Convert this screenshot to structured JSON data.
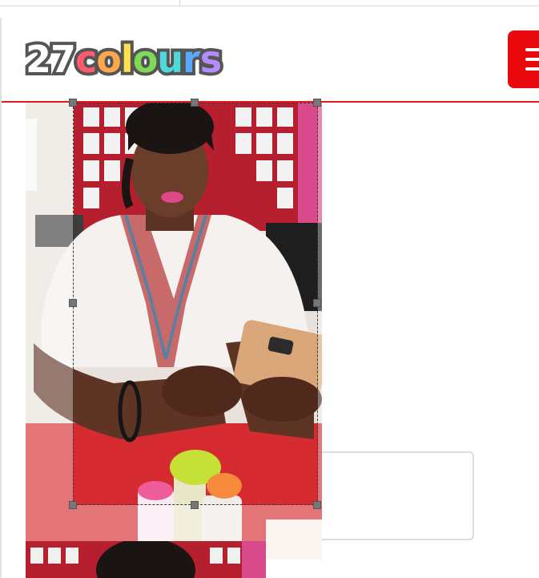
{
  "header": {
    "logo": {
      "number": "27",
      "letters": [
        {
          "char": "c",
          "color": "#ff5a6e"
        },
        {
          "char": "o",
          "color": "#ffa64d"
        },
        {
          "char": "l",
          "color": "#ffe14d"
        },
        {
          "char": "o",
          "color": "#7ed957"
        },
        {
          "char": "u",
          "color": "#4dd9d9"
        },
        {
          "char": "r",
          "color": "#5aa9ff"
        },
        {
          "char": "s",
          "color": "#b58cff"
        }
      ],
      "number_color": "#ffffff",
      "outline_color": "#555555"
    },
    "menu_icon": "hamburger-icon",
    "accent_color": "#e8090f"
  },
  "editor": {
    "photo_subject": "woman-using-smartphone",
    "crop_overlay": true
  }
}
